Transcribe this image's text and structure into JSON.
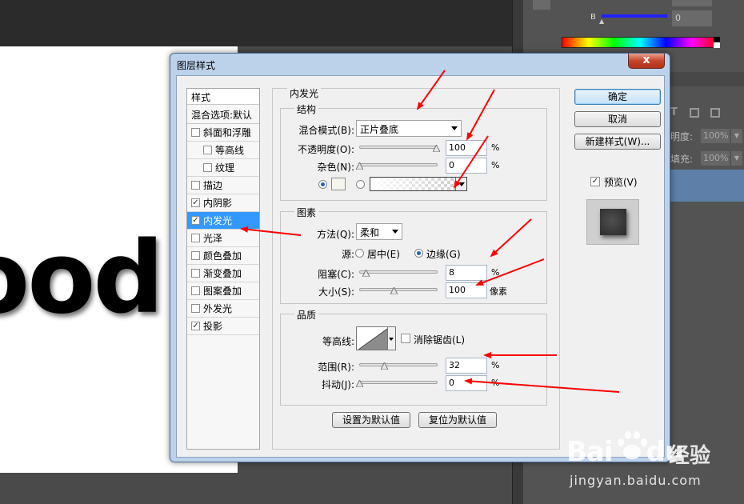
{
  "canvas": {
    "text": "ood"
  },
  "photoshop": {
    "channel_b_label": "B",
    "channel_b_value": "0",
    "opacity_label": "明度:",
    "opacity_value": "100%",
    "fill_label": "填充:",
    "fill_value": "100%"
  },
  "dialog": {
    "title": "图层样式",
    "close_label": "x",
    "styles_header": "样式",
    "blend_options": "混合选项:默认",
    "style_items": [
      {
        "label": "斜面和浮雕",
        "checked": false
      },
      {
        "label": "等高线",
        "checked": false
      },
      {
        "label": "纹理",
        "checked": false
      },
      {
        "label": "描边",
        "checked": false
      },
      {
        "label": "内阴影",
        "checked": true
      },
      {
        "label": "内发光",
        "checked": true,
        "active": true
      },
      {
        "label": "光泽",
        "checked": false
      },
      {
        "label": "颜色叠加",
        "checked": false
      },
      {
        "label": "渐变叠加",
        "checked": false
      },
      {
        "label": "图案叠加",
        "checked": false
      },
      {
        "label": "外发光",
        "checked": false
      },
      {
        "label": "投影",
        "checked": true
      }
    ],
    "inner_glow": {
      "title": "内发光",
      "structure": {
        "title": "结构",
        "blend_mode_label": "混合模式(B):",
        "blend_mode_value": "正片叠底",
        "opacity_label": "不透明度(O):",
        "opacity_value": "100",
        "noise_label": "杂色(N):",
        "noise_value": "0",
        "percent": "%"
      },
      "elements": {
        "title": "图素",
        "method_label": "方法(Q):",
        "method_value": "柔和",
        "source_label": "源:",
        "source_center": "居中(E)",
        "source_edge": "边缘(G)",
        "choke_label": "阻塞(C):",
        "choke_value": "8",
        "size_label": "大小(S):",
        "size_value": "100",
        "percent": "%",
        "pixels": "像素"
      },
      "quality": {
        "title": "品质",
        "contour_label": "等高线:",
        "anti_alias_label": "消除锯齿(L)",
        "range_label": "范围(R):",
        "range_value": "32",
        "jitter_label": "抖动(J):",
        "jitter_value": "0",
        "percent": "%"
      },
      "make_default": "设置为默认值",
      "reset_default": "复位为默认值"
    },
    "buttons": {
      "ok": "确定",
      "cancel": "取消",
      "new_style": "新建样式(W)...",
      "preview": "预览(V)"
    }
  },
  "watermark": {
    "logo": "Bai",
    "logo_end": "du",
    "suffix": "经验",
    "url": "jingyan.baidu.com"
  },
  "colors": {
    "annotation_arrow": "#ff0000",
    "selection": "#3399ff",
    "dialog_frame": "#bcd2ea"
  }
}
